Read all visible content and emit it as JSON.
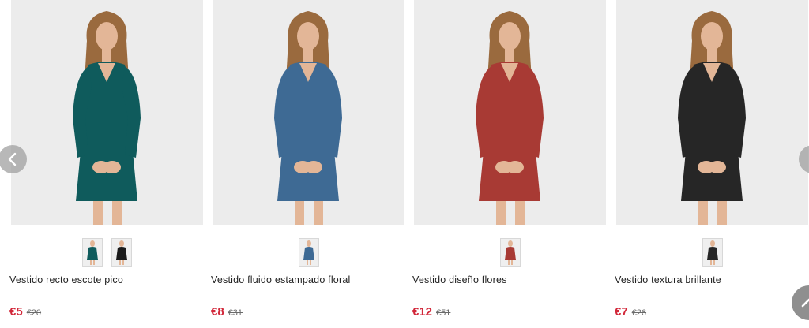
{
  "products": [
    {
      "name": "Vestido recto escote pico",
      "price": "€5",
      "original_price": "€20",
      "dress_color": "#0f5b5c",
      "thumbs": [
        "#0f5b5c",
        "#1a1a1a"
      ]
    },
    {
      "name": "Vestido fluido estampado floral",
      "price": "€8",
      "original_price": "€31",
      "dress_color": "#3e6a94",
      "thumbs": [
        "#3e6a94"
      ]
    },
    {
      "name": "Vestido diseño flores",
      "price": "€12",
      "original_price": "€51",
      "dress_color": "#a83a34",
      "thumbs": [
        "#a83a34"
      ]
    },
    {
      "name": "Vestido textura brillante",
      "price": "€7",
      "original_price": "€26",
      "dress_color": "#262626",
      "thumbs": [
        "#262626"
      ]
    }
  ],
  "icons": {
    "prev": "chevron-left-icon",
    "next": "chevron-right-icon",
    "scroll_top": "chevron-up-icon"
  },
  "colors": {
    "price": "#d2283a",
    "image_background": "#ececec",
    "hair": "#9a6a3e",
    "skin": "#e3b697"
  }
}
